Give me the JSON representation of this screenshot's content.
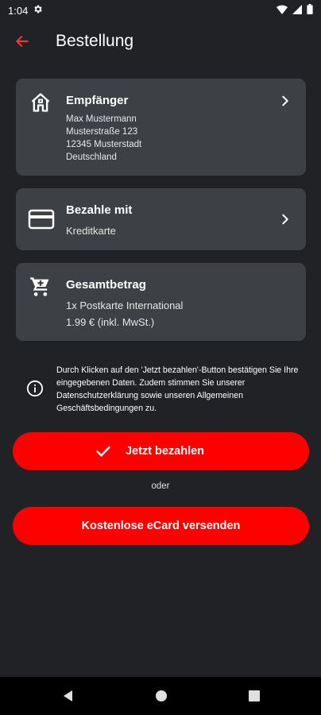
{
  "status": {
    "time": "1:04"
  },
  "appbar": {
    "title": "Bestellung"
  },
  "recipient": {
    "title": "Empfänger",
    "lines": [
      "Max Mustermann",
      "Musterstraße 123",
      "12345 Musterstadt",
      "Deutschland"
    ]
  },
  "payment": {
    "title": "Bezahle mit",
    "method": "Kreditkarte"
  },
  "total": {
    "title": "Gesamtbetrag",
    "item": "1x Postkarte International",
    "price": "1.99 € (inkl. MwSt.)"
  },
  "info": {
    "text": "Durch Klicken auf den 'Jetzt bezahlen'-Button bestätigen Sie Ihre eingegebenen Daten. Zudem stimmen Sie unserer Datenschutzerklärung sowie unseren Allgemeinen Geschäftsbedingungen zu."
  },
  "buttons": {
    "pay": "Jetzt bezahlen",
    "or": "oder",
    "ecard": "Kostenlose eCard versenden"
  },
  "colors": {
    "accent": "#ff0000",
    "background": "#212225",
    "card": "#3d4146",
    "back_arrow": "#e53935"
  }
}
